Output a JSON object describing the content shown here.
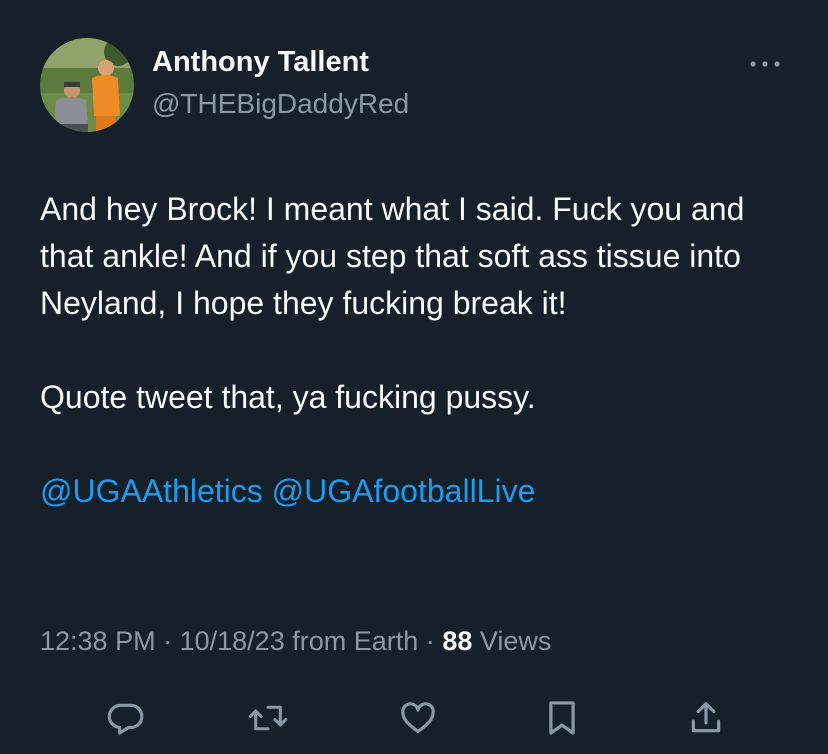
{
  "colors": {
    "background": "#15202b",
    "primary_text": "#f7f9f9",
    "secondary_text": "#8b98a5",
    "link": "#1d9bf0"
  },
  "author": {
    "display_name": "Anthony Tallent",
    "handle": "@THEBigDaddyRed",
    "avatar_icon": "profile-photo"
  },
  "tweet": {
    "lines": [
      "And hey Brock! I meant what I said. Fuck you and that ankle! And if you step that soft ass tissue into Neyland, I hope they fucking break it!",
      "Quote tweet that, ya fucking pussy."
    ],
    "mentions": [
      "@UGAAthletics",
      "@UGAfootballLive"
    ]
  },
  "meta": {
    "time": "12:38 PM",
    "date": "10/18/23",
    "source": "from Earth",
    "views_count": "88",
    "views_label": "Views",
    "separator": "·"
  },
  "actions": [
    {
      "icon": "reply-icon"
    },
    {
      "icon": "retweet-icon"
    },
    {
      "icon": "like-icon"
    },
    {
      "icon": "bookmark-icon"
    },
    {
      "icon": "share-icon"
    }
  ]
}
